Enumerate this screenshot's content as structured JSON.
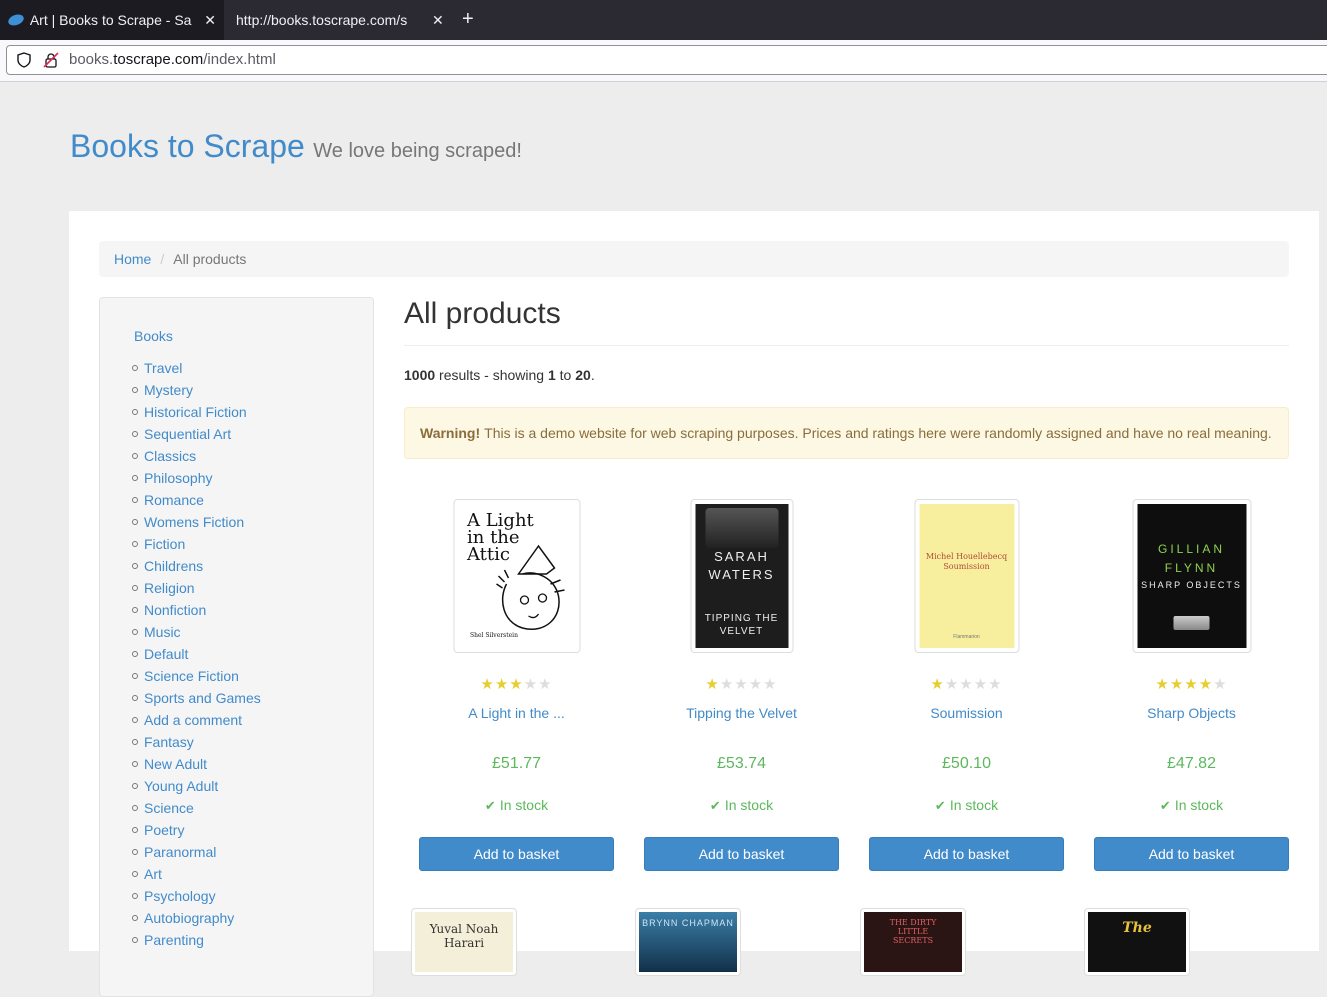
{
  "browser": {
    "tabs": [
      {
        "title": "Art | Books to Scrape - Sa",
        "active": true
      },
      {
        "title": "http://books.toscrape.com/s",
        "active": false
      }
    ],
    "new_tab": "+",
    "url_prefix": "books.",
    "url_domain": "toscrape.com",
    "url_path": "/index.html"
  },
  "site": {
    "name": "Books to Scrape",
    "tagline": "We love being scraped!"
  },
  "breadcrumb": {
    "home": "Home",
    "sep": "/",
    "current": "All products"
  },
  "sidebar": {
    "root": "Books",
    "categories": [
      "Travel",
      "Mystery",
      "Historical Fiction",
      "Sequential Art",
      "Classics",
      "Philosophy",
      "Romance",
      "Womens Fiction",
      "Fiction",
      "Childrens",
      "Religion",
      "Nonfiction",
      "Music",
      "Default",
      "Science Fiction",
      "Sports and Games",
      "Add a comment",
      "Fantasy",
      "New Adult",
      "Young Adult",
      "Science",
      "Poetry",
      "Paranormal",
      "Art",
      "Psychology",
      "Autobiography",
      "Parenting"
    ]
  },
  "main": {
    "title": "All products",
    "results_total": "1000",
    "results_mid": " results - showing ",
    "results_from": "1",
    "results_to_word": " to ",
    "results_to": "20",
    "results_end": ".",
    "warning_label": "Warning!",
    "warning_text": "This is a demo website for web scraping purposes. Prices and ratings here were randomly assigned and have no real meaning."
  },
  "products": [
    {
      "title": "A Light in the ...",
      "rating": 3,
      "price": "£51.77",
      "stock": "In stock",
      "button": "Add to basket",
      "cover_lines": [
        "A Light",
        "in the",
        "Attic"
      ],
      "cover_sub": "Shel Silverstein"
    },
    {
      "title": "Tipping the Velvet",
      "rating": 1,
      "price": "£53.74",
      "stock": "In stock",
      "button": "Add to basket",
      "cover_lines": [
        "SARAH",
        "WATERS"
      ],
      "cover_sub": "TIPPING THE VELVET"
    },
    {
      "title": "Soumission",
      "rating": 1,
      "price": "£50.10",
      "stock": "In stock",
      "button": "Add to basket",
      "cover_lines": [
        "Michel Houellebecq",
        "Soumission"
      ],
      "cover_sub": "Flammarion"
    },
    {
      "title": "Sharp Objects",
      "rating": 4,
      "price": "£47.82",
      "stock": "In stock",
      "button": "Add to basket",
      "cover_lines": [
        "GILLIAN",
        "FLYNN"
      ],
      "cover_sub": "SHARP OBJECTS"
    }
  ],
  "row2_covers": [
    {
      "cover_lines": [
        "Yuval Noah",
        "Harari"
      ]
    },
    {
      "cover_lines": [
        "BRYNN CHAPMAN"
      ]
    },
    {
      "cover_lines": [
        "THE DIRTY",
        "LITTLE",
        "SECRETS"
      ]
    },
    {
      "cover_lines": [
        "The"
      ]
    }
  ],
  "colors": {
    "link": "#428bca",
    "price": "#5cb85c",
    "star": "#E6CE31",
    "button": "#428bca"
  }
}
